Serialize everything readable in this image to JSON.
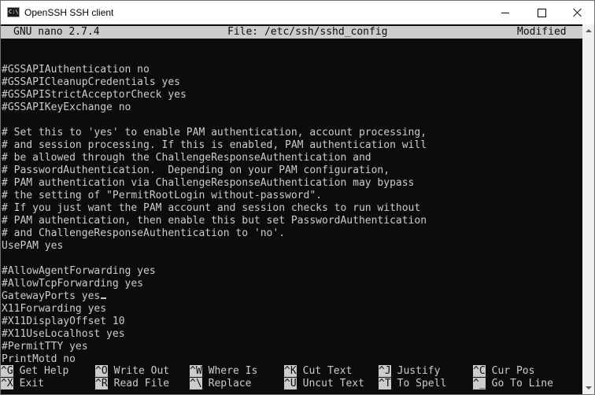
{
  "window": {
    "title": "OpenSSH SSH client",
    "icon": "console-icon",
    "icon_text": "C:\\."
  },
  "nano": {
    "version": "GNU nano 2.7.4",
    "file": "File: /etc/ssh/sshd_config",
    "status": "Modified"
  },
  "lines": [
    "",
    "#GSSAPIAuthentication no",
    "#GSSAPICleanupCredentials yes",
    "#GSSAPIStrictAcceptorCheck yes",
    "#GSSAPIKeyExchange no",
    "",
    "# Set this to 'yes' to enable PAM authentication, account processing,",
    "# and session processing. If this is enabled, PAM authentication will",
    "# be allowed through the ChallengeResponseAuthentication and",
    "# PasswordAuthentication.  Depending on your PAM configuration,",
    "# PAM authentication via ChallengeResponseAuthentication may bypass",
    "# the setting of \"PermitRootLogin without-password\".",
    "# If you just want the PAM account and session checks to run without",
    "# PAM authentication, then enable this but set PasswordAuthentication",
    "# and ChallengeResponseAuthentication to 'no'.",
    "UsePAM yes",
    "",
    "#AllowAgentForwarding yes",
    "#AllowTcpForwarding yes",
    "GatewayPorts yes",
    "X11Forwarding yes",
    "#X11DisplayOffset 10",
    "#X11UseLocalhost yes",
    "#PermitTTY yes",
    "PrintMotd no"
  ],
  "shortcuts_row1": [
    {
      "key": "^G",
      "label": "Get Help"
    },
    {
      "key": "^O",
      "label": "Write Out"
    },
    {
      "key": "^W",
      "label": "Where Is"
    },
    {
      "key": "^K",
      "label": "Cut Text"
    },
    {
      "key": "^J",
      "label": "Justify"
    },
    {
      "key": "^C",
      "label": "Cur Pos"
    }
  ],
  "shortcuts_row2": [
    {
      "key": "^X",
      "label": "Exit"
    },
    {
      "key": "^R",
      "label": "Read File"
    },
    {
      "key": "^\\",
      "label": "Replace"
    },
    {
      "key": "^U",
      "label": "Uncut Text"
    },
    {
      "key": "^T",
      "label": "To Spell"
    },
    {
      "key": "^_",
      "label": "Go To Line"
    }
  ],
  "colors": {
    "background": "#0c0c0c",
    "foreground": "#cccccc",
    "titlebar": "#ffffff"
  }
}
